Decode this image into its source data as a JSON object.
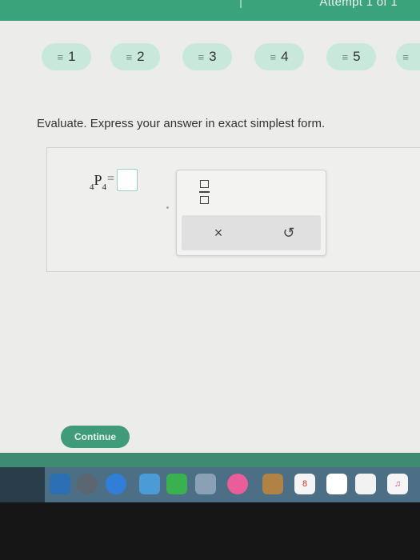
{
  "header": {
    "attempt_text": "Attempt 1 of 1"
  },
  "questions": [
    {
      "number": "1",
      "icon": "≡"
    },
    {
      "number": "2",
      "icon": "≡"
    },
    {
      "number": "3",
      "icon": "≡"
    },
    {
      "number": "4",
      "icon": "≡"
    },
    {
      "number": "5",
      "icon": "≡"
    },
    {
      "number": "",
      "icon": "≡"
    }
  ],
  "problem": {
    "prompt": "Evaluate. Express your answer in exact simplest form.",
    "pre_sub": "4",
    "symbol": "P",
    "post_sub": "4",
    "equals": "="
  },
  "answer": {
    "value": ""
  },
  "palette": {
    "clear_label": "×",
    "undo_label": "↺"
  },
  "footer": {
    "continue_label": "Continue"
  },
  "dock": {
    "calendar_day": "8"
  },
  "colors": {
    "header_green": "#3aa37c",
    "pill_green": "#c7e8da",
    "continue_green": "#3f9b7a"
  }
}
